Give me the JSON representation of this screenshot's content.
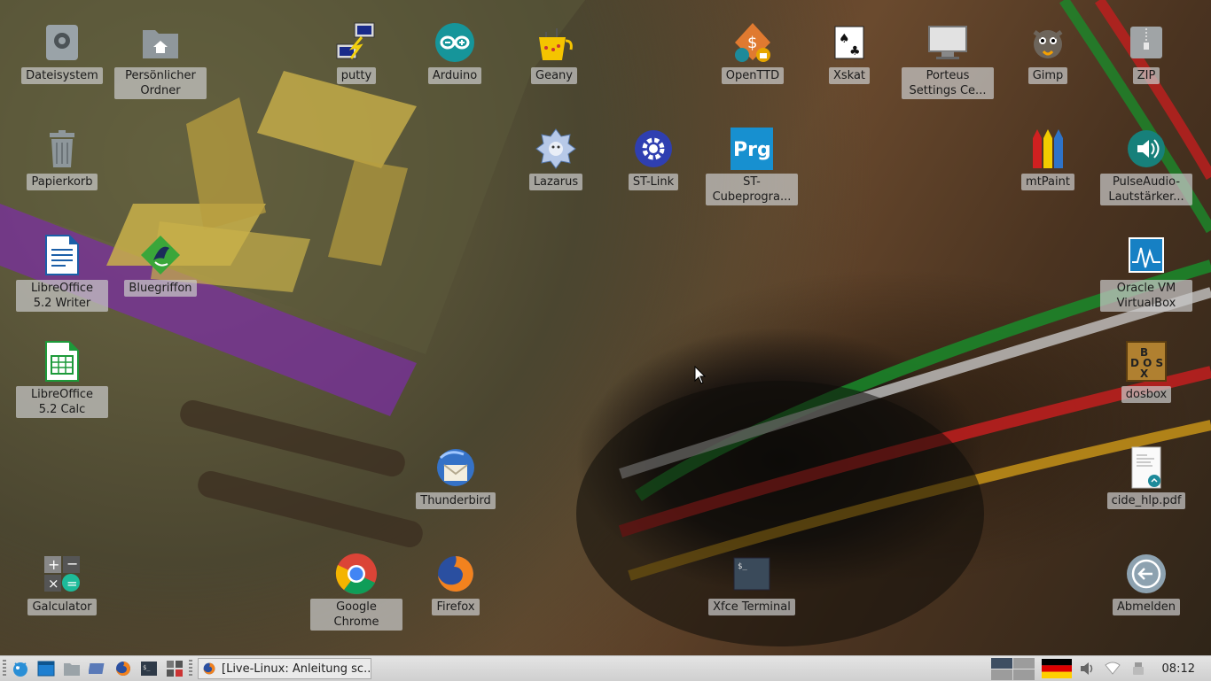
{
  "desktop": {
    "icons": [
      {
        "label": "Dateisystem",
        "icon": "drive-icon"
      },
      {
        "label": "Persönlicher Ordner",
        "icon": "home-folder-icon"
      },
      {
        "label": "putty",
        "icon": "putty-icon"
      },
      {
        "label": "Arduino",
        "icon": "arduino-icon"
      },
      {
        "label": "Geany",
        "icon": "geany-icon"
      },
      {
        "label": "OpenTTD",
        "icon": "openttd-icon"
      },
      {
        "label": "Xskat",
        "icon": "cards-icon"
      },
      {
        "label": "Porteus Settings Ce...",
        "icon": "monitor-icon"
      },
      {
        "label": "Gimp",
        "icon": "gimp-icon"
      },
      {
        "label": "ZIP",
        "icon": "zip-icon"
      },
      {
        "label": "Papierkorb",
        "icon": "trash-icon"
      },
      {
        "label": "Lazarus",
        "icon": "lazarus-icon"
      },
      {
        "label": "ST-Link",
        "icon": "gear-icon"
      },
      {
        "label": "ST-Cubeprogra...",
        "icon": "prg-icon",
        "badge": "Prg"
      },
      {
        "label": "mtPaint",
        "icon": "pencils-icon"
      },
      {
        "label": "PulseAudio-Lautstärker...",
        "icon": "speaker-icon"
      },
      {
        "label": "LibreOffice 5.2 Writer",
        "icon": "writer-icon"
      },
      {
        "label": "Bluegriffon",
        "icon": "bluegriffon-icon"
      },
      {
        "label": "Oracle VM VirtualBox",
        "icon": "virtualbox-icon"
      },
      {
        "label": "LibreOffice 5.2 Calc",
        "icon": "calc-icon"
      },
      {
        "label": "dosbox",
        "icon": "dosbox-icon",
        "badge": "BOX"
      },
      {
        "label": "Thunderbird",
        "icon": "thunderbird-icon"
      },
      {
        "label": "cide_hlp.pdf",
        "icon": "pdf-icon"
      },
      {
        "label": "Galculator",
        "icon": "calculator-icon"
      },
      {
        "label": "Google Chrome",
        "icon": "chrome-icon"
      },
      {
        "label": "Firefox",
        "icon": "firefox-icon"
      },
      {
        "label": "Xfce Terminal",
        "icon": "terminal-icon",
        "badge": "$_"
      },
      {
        "label": "Abmelden",
        "icon": "logout-icon"
      }
    ]
  },
  "taskbar": {
    "launchers": [
      "app-menu-icon",
      "show-desktop-icon",
      "file-manager-icon",
      "browser-window-icon",
      "firefox-icon",
      "terminal-icon",
      "settings-icon"
    ],
    "task_title": "[Live-Linux: Anleitung sc...",
    "clock": "08:12",
    "keyboard_layout_flag": "de-flag-icon"
  },
  "colors": {
    "label_bg": "#c8c8c8",
    "taskbar_bg": "#d8d8d8",
    "workspace_active": "#3e4e62"
  }
}
